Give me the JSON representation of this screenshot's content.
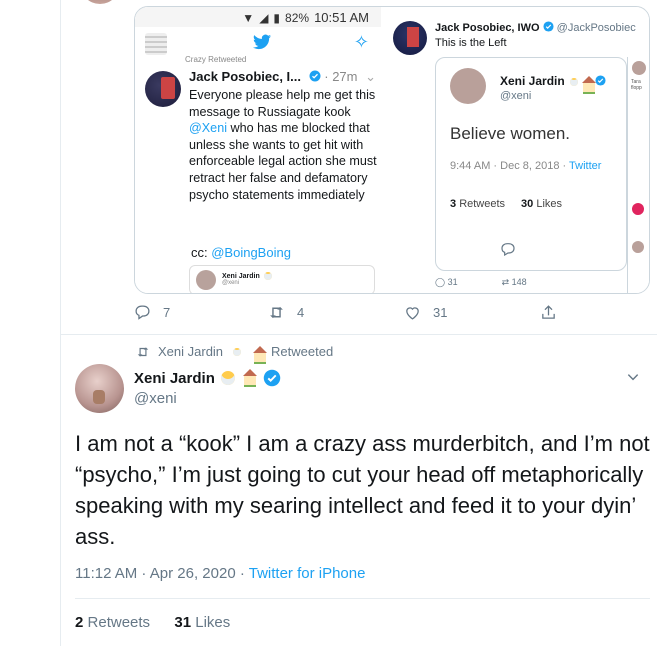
{
  "colors": {
    "accent": "#1da1f2",
    "muted": "#657786",
    "text": "#14171a",
    "border": "#ccd6dd",
    "like": "#e0245e"
  },
  "phone": {
    "status_battery": "82%",
    "status_time": "10:51 AM",
    "retweeted_label": "Crazy Retweeted",
    "author": "Jack Posobiec, I...",
    "time_ago": "27m",
    "body_pre": "Everyone please help me get this message to Russiagate kook ",
    "body_mention": "@Xeni",
    "body_post": " who has me blocked that unless she wants to get hit with enforceable legal action she must retract her false and defamatory psycho statements immediately",
    "cc_prefix": "cc: ",
    "cc_mention": "@BoingBoing",
    "quote_name": "Xeni Jardin",
    "quote_handle": "@xeni"
  },
  "embed": {
    "author": "Jack Posobiec, IWO",
    "handle": "@JackPosobiec",
    "text": "This is the Left",
    "card_name": "Xeni Jardin",
    "card_handle": "@xeni",
    "card_body": "Believe women.",
    "card_time": "9:44 AM · Dec 8, 2018 · ",
    "card_source": "Twitter",
    "card_retweets": "3",
    "card_retweets_label": "Retweets",
    "card_likes": "30",
    "card_likes_label": "Likes",
    "replies": "31",
    "retweets": "148",
    "strip_text": "Tara flopp"
  },
  "actions": {
    "replies": "7",
    "retweets": "4",
    "likes": "31"
  },
  "retweet_header": {
    "by": "Xeni Jardin",
    "label": "Retweeted"
  },
  "main": {
    "name": "Xeni Jardin",
    "handle": "@xeni",
    "text": "I am not a “kook” I am a crazy ass murderbitch, and I’m not “psycho,” I’m just going to cut your head off metaphorically speaking with my searing intellect and feed it to your dyin’ ass.",
    "time": "11:12 AM · Apr 26, 2020 · ",
    "source": "Twitter for iPhone",
    "retweets": "2",
    "retweets_label": "Retweets",
    "likes": "31",
    "likes_label": "Likes"
  },
  "icons": [
    "reply-icon",
    "retweet-icon",
    "like-icon",
    "share-icon",
    "verified-icon",
    "chevron-down-icon",
    "twitter-bird-icon",
    "sparkle-icon",
    "mask-emoji-icon",
    "house-emoji-icon"
  ]
}
